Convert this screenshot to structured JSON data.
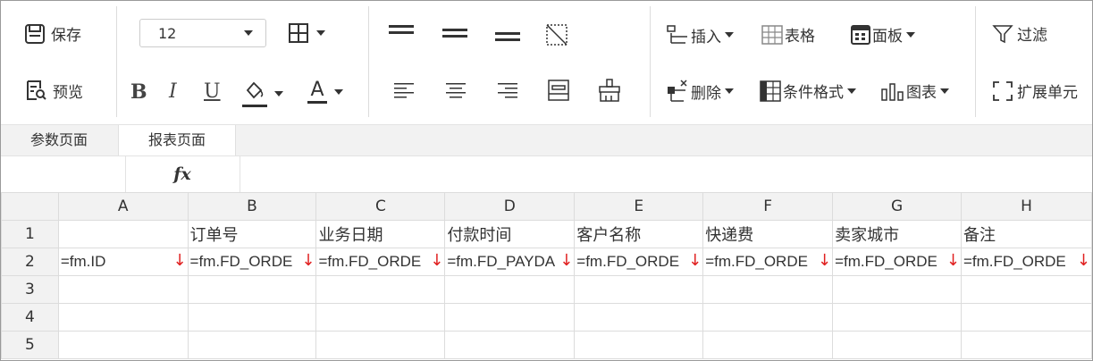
{
  "toolbar": {
    "save_label": "保存",
    "preview_label": "预览",
    "font_size": "12",
    "bold_label": "B",
    "italic_label": "I",
    "underline_label": "U",
    "font_color_label": "A",
    "insert_label": "插入",
    "delete_label": "删除",
    "table_label": "表格",
    "conditional_format_label": "条件格式",
    "panel_label": "面板",
    "chart_label": "图表",
    "filter_label": "过滤",
    "expand_cell_label": "扩展单元",
    "accent_fill_color": "#2f2f2f",
    "accent_font_color": "#d03030"
  },
  "tabs": [
    {
      "label": "参数页面"
    },
    {
      "label": "报表页面"
    }
  ],
  "formula_bar": {
    "fx_label": "fx"
  },
  "grid": {
    "columns": [
      "A",
      "B",
      "C",
      "D",
      "E",
      "F",
      "G",
      "H"
    ],
    "rows": [
      "1",
      "2",
      "3",
      "4",
      "5"
    ],
    "row1": [
      "",
      "订单号",
      "业务日期",
      "付款时间",
      "客户名称",
      "快递费",
      "卖家城市",
      "备注"
    ],
    "row2": [
      "=fm.ID",
      "=fm.FD_ORDE",
      "=fm.FD_ORDE",
      "=fm.FD_PAYDA",
      "=fm.FD_ORDE",
      "=fm.FD_ORDE",
      "=fm.FD_ORDE",
      "=fm.FD_ORDE"
    ],
    "expand_arrow": "↓",
    "expand_arrow_color": "#e02020"
  }
}
